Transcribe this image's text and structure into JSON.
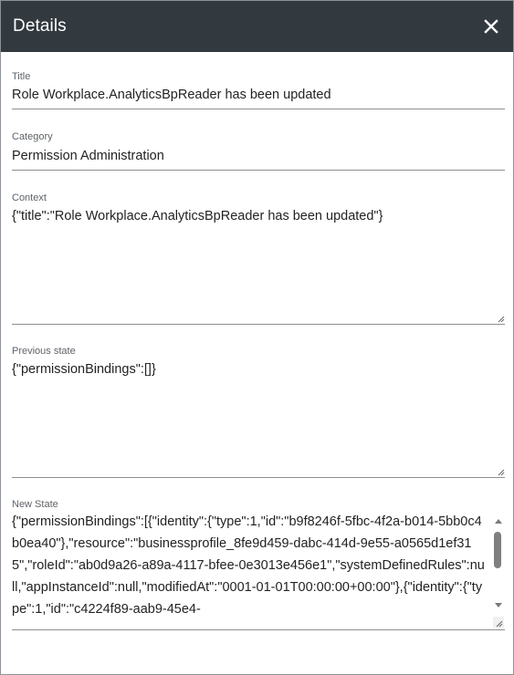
{
  "header": {
    "title": "Details",
    "close_icon": "close-icon"
  },
  "fields": {
    "title": {
      "label": "Title",
      "value": "Role Workplace.AnalyticsBpReader has been updated"
    },
    "category": {
      "label": "Category",
      "value": "Permission Administration"
    },
    "context": {
      "label": "Context",
      "value": "{\"title\":\"Role Workplace.AnalyticsBpReader has been updated\"}"
    },
    "previous_state": {
      "label": "Previous state",
      "value": "{\"permissionBindings\":[]}"
    },
    "new_state": {
      "label": "New State",
      "value": "{\"permissionBindings\":[{\"identity\":{\"type\":1,\"id\":\"b9f8246f-5fbc-4f2a-b014-5bb0c4b0ea40\"},\"resource\":\"businessprofile_8fe9d459-dabc-414d-9e55-a0565d1ef315\",\"roleId\":\"ab0d9a26-a89a-4117-bfee-0e3013e456e1\",\"systemDefinedRules\":null,\"appInstanceId\":null,\"modifiedAt\":\"0001-01-01T00:00:00+00:00\"},{\"identity\":{\"type\":1,\"id\":\"c4224f89-aab9-45e4-"
    }
  },
  "colors": {
    "header_bg": "#32393f",
    "header_text": "#ffffff",
    "label": "#5f6368",
    "value": "#222222",
    "underline": "#8f8f8f"
  }
}
